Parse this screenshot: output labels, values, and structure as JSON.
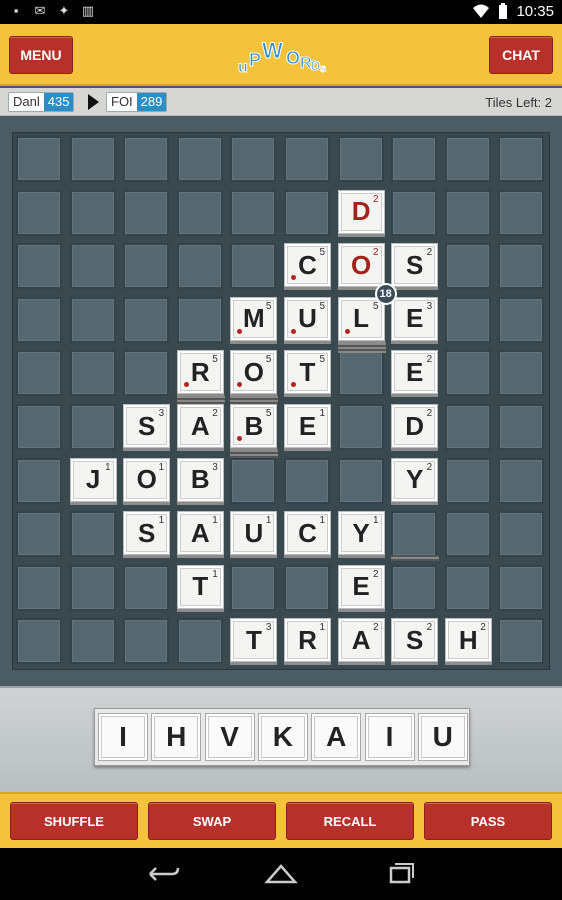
{
  "status_bar": {
    "time": "10:35"
  },
  "header": {
    "menu_label": "MENU",
    "chat_label": "CHAT",
    "logo_text": "uPWORDs"
  },
  "scores": {
    "players": [
      {
        "name": "Danl",
        "score": "435"
      },
      {
        "name": "FOI",
        "score": "289"
      }
    ],
    "tiles_left": "Tiles Left: 2"
  },
  "board": {
    "size": 10,
    "tiles": [
      {
        "row": 1,
        "col": 6,
        "letter": "D",
        "height": "2",
        "red": true
      },
      {
        "row": 2,
        "col": 5,
        "letter": "C",
        "height": "5",
        "dot": true
      },
      {
        "row": 2,
        "col": 6,
        "letter": "O",
        "height": "2",
        "red": true
      },
      {
        "row": 2,
        "col": 7,
        "letter": "S",
        "height": "2"
      },
      {
        "row": 3,
        "col": 4,
        "letter": "M",
        "height": "5",
        "dot": true
      },
      {
        "row": 3,
        "col": 5,
        "letter": "U",
        "height": "5",
        "dot": true
      },
      {
        "row": 3,
        "col": 6,
        "letter": "L",
        "height": "5",
        "dot": true
      },
      {
        "row": 3,
        "col": 7,
        "letter": "E",
        "height": "3"
      },
      {
        "row": 4,
        "col": 3,
        "letter": "R",
        "height": "5",
        "dot": true
      },
      {
        "row": 4,
        "col": 4,
        "letter": "O",
        "height": "5",
        "dot": true
      },
      {
        "row": 4,
        "col": 5,
        "letter": "T",
        "height": "5",
        "dot": true
      },
      {
        "row": 4,
        "col": 7,
        "letter": "E",
        "height": "2"
      },
      {
        "row": 5,
        "col": 2,
        "letter": "S",
        "height": "3"
      },
      {
        "row": 5,
        "col": 3,
        "letter": "A",
        "height": "2"
      },
      {
        "row": 5,
        "col": 4,
        "letter": "B",
        "height": "5",
        "dot": true
      },
      {
        "row": 5,
        "col": 5,
        "letter": "E",
        "height": "1"
      },
      {
        "row": 5,
        "col": 7,
        "letter": "D",
        "height": "2"
      },
      {
        "row": 6,
        "col": 1,
        "letter": "J",
        "height": "1"
      },
      {
        "row": 6,
        "col": 2,
        "letter": "O",
        "height": "1"
      },
      {
        "row": 6,
        "col": 3,
        "letter": "B",
        "height": "3"
      },
      {
        "row": 6,
        "col": 7,
        "letter": "Y",
        "height": "2"
      },
      {
        "row": 7,
        "col": 2,
        "letter": "S",
        "height": "1"
      },
      {
        "row": 7,
        "col": 3,
        "letter": "A",
        "height": "1"
      },
      {
        "row": 7,
        "col": 4,
        "letter": "U",
        "height": "1"
      },
      {
        "row": 7,
        "col": 5,
        "letter": "C",
        "height": "1"
      },
      {
        "row": 7,
        "col": 6,
        "letter": "Y",
        "height": "1"
      },
      {
        "row": 8,
        "col": 3,
        "letter": "T",
        "height": "1"
      },
      {
        "row": 8,
        "col": 6,
        "letter": "E",
        "height": "2"
      },
      {
        "row": 9,
        "col": 4,
        "letter": "T",
        "height": "3"
      },
      {
        "row": 9,
        "col": 5,
        "letter": "R",
        "height": "1"
      },
      {
        "row": 9,
        "col": 6,
        "letter": "A",
        "height": "2"
      },
      {
        "row": 9,
        "col": 7,
        "letter": "S",
        "height": "2"
      },
      {
        "row": 9,
        "col": 8,
        "letter": "H",
        "height": "2"
      }
    ],
    "stacks": [
      {
        "row": 3,
        "col": 6,
        "depth": 5
      },
      {
        "row": 4,
        "col": 3,
        "depth": 4
      },
      {
        "row": 4,
        "col": 4,
        "depth": 4
      },
      {
        "row": 5,
        "col": 4,
        "depth": 4
      },
      {
        "row": 7,
        "col": 7,
        "depth": 2
      }
    ],
    "score_badge": {
      "row": 3,
      "col": 6,
      "value": "18"
    }
  },
  "rack": {
    "tiles": [
      "I",
      "H",
      "V",
      "K",
      "A",
      "I",
      "U"
    ]
  },
  "actions": {
    "shuffle": "SHUFFLE",
    "swap": "SWAP",
    "recall": "RECALL",
    "pass": "PASS"
  },
  "colors": {
    "header": "#f5c33b",
    "button": "#b8302a",
    "score_badge": "#2d8ec7",
    "accent_red": "#a3231c"
  }
}
